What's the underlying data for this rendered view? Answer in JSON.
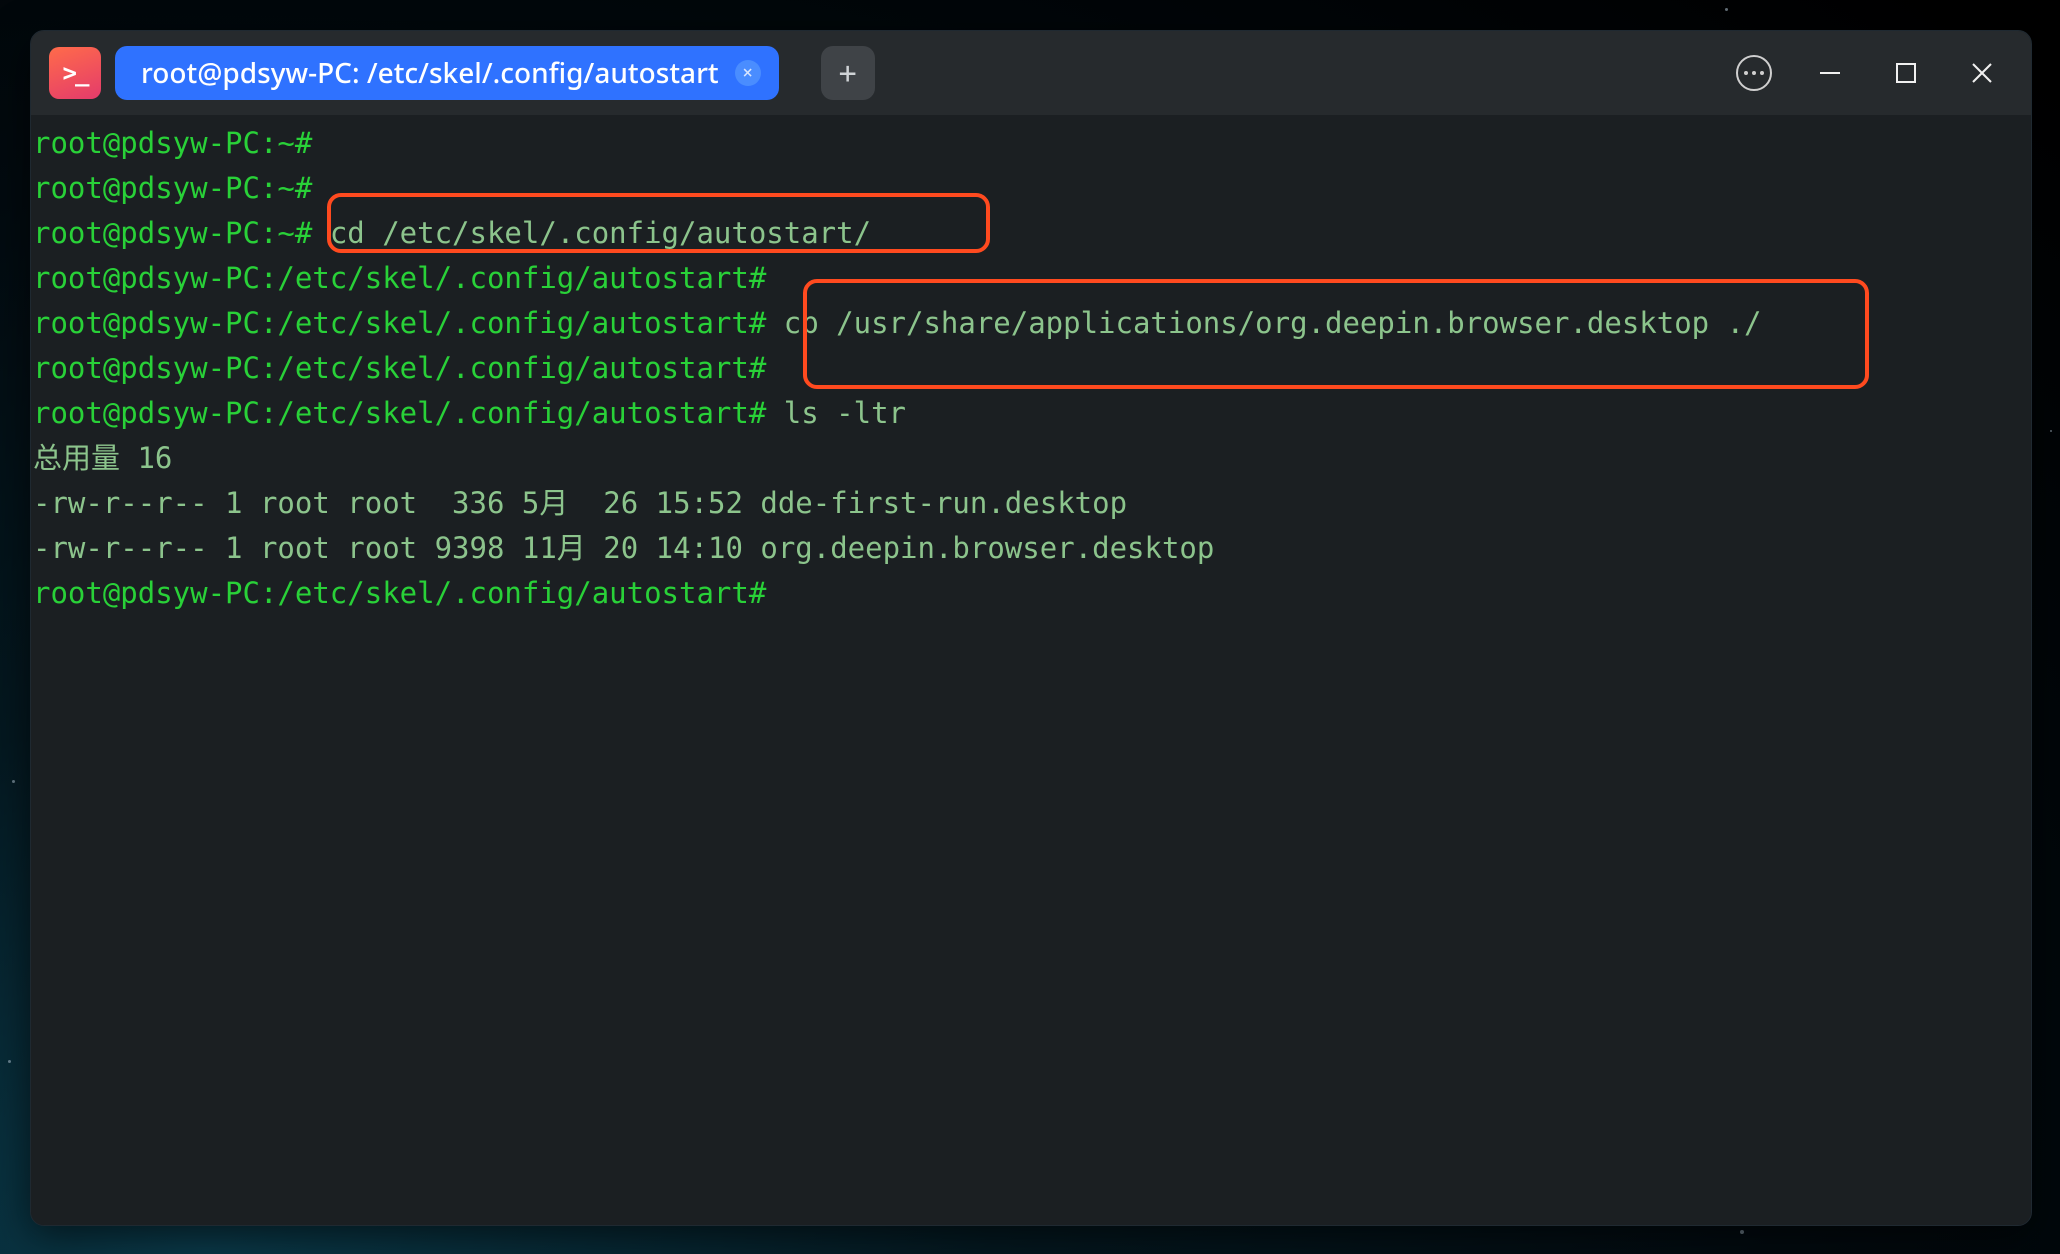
{
  "titlebar": {
    "app_icon_text": ">_",
    "tab_title": "root@pdsyw-PC: /etc/skel/.config/autostart",
    "tab_close_glyph": "×",
    "new_tab_glyph": "+"
  },
  "prompts": {
    "home": "root@pdsyw-PC:~#",
    "autostart": "root@pdsyw-PC:/etc/skel/.config/autostart#"
  },
  "commands": {
    "cd": " cd /etc/skel/.config/autostart/",
    "cp": " cp /usr/share/applications/org.deepin.browser.desktop ./",
    "ls": " ls -ltr"
  },
  "output": {
    "total": "总用量 16",
    "row1": "-rw-r--r-- 1 root root  336 5月  26 15:52 dde-first-run.desktop",
    "row2": "-rw-r--r-- 1 root root 9398 11月 20 14:10 org.deepin.browser.desktop"
  }
}
